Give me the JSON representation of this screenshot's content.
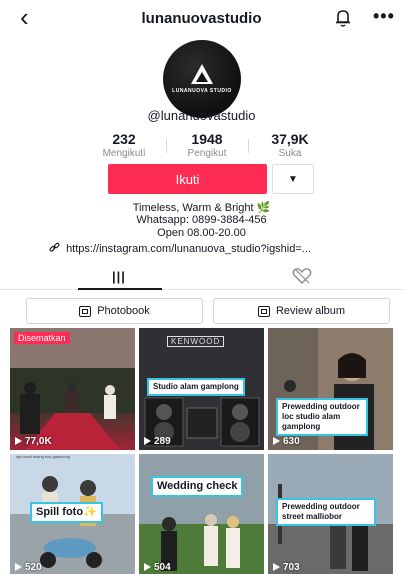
{
  "header": {
    "title": "lunanuovastudio"
  },
  "profile": {
    "avatar_brand": "LUNANUOVA STUDIO",
    "handle": "@lunanuovastudio",
    "stats": [
      {
        "value": "232",
        "label": "Mengikuti"
      },
      {
        "value": "1948",
        "label": "Pengikut"
      },
      {
        "value": "37,9K",
        "label": "Suka"
      }
    ],
    "follow_label": "Ikuti",
    "bio": {
      "line1": "Timeless, Warm & Bright",
      "line1_emoji": "🌿",
      "line2": "Whatsapp: 0899-3884-456",
      "line3": "Open 08.00-20.00"
    },
    "link": "https://instagram.com/lunanuova_studio?igshid=..."
  },
  "albums": {
    "photobook": "Photobook",
    "review": "Review album"
  },
  "videos": [
    {
      "views": "77,0K",
      "pinned": "Disematkan",
      "caption": "",
      "sub_caption": "spil modi akang bos gamplong"
    },
    {
      "views": "289",
      "caption": "Studio alam gamplong",
      "brand": "KENWOOD"
    },
    {
      "views": "630",
      "caption": "Prewedding outdoor loc studio alam gamplong"
    },
    {
      "views": "520",
      "caption": "Spill foto✨"
    },
    {
      "views": "504",
      "caption": "Wedding check"
    },
    {
      "views": "703",
      "caption": "Prewedding outdoor street malliobor"
    }
  ],
  "colors": {
    "accent": "#fe2c55",
    "caption_border": "#36c4e3"
  }
}
